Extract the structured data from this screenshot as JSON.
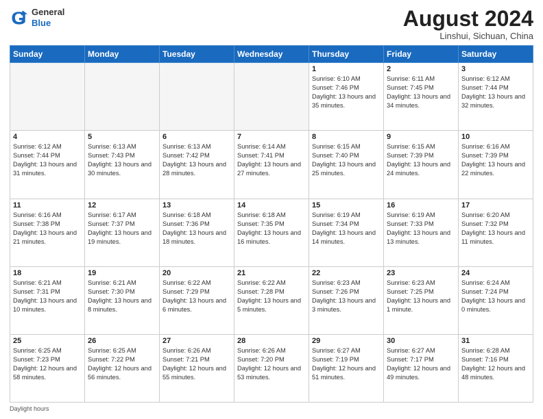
{
  "header": {
    "logo_general": "General",
    "logo_blue": "Blue",
    "month_title": "August 2024",
    "location": "Linshui, Sichuan, China"
  },
  "days_of_week": [
    "Sunday",
    "Monday",
    "Tuesday",
    "Wednesday",
    "Thursday",
    "Friday",
    "Saturday"
  ],
  "weeks": [
    [
      {
        "day": "",
        "empty": true
      },
      {
        "day": "",
        "empty": true
      },
      {
        "day": "",
        "empty": true
      },
      {
        "day": "",
        "empty": true
      },
      {
        "day": "1",
        "sunrise": "6:10 AM",
        "sunset": "7:46 PM",
        "daylight": "13 hours and 35 minutes."
      },
      {
        "day": "2",
        "sunrise": "6:11 AM",
        "sunset": "7:45 PM",
        "daylight": "13 hours and 34 minutes."
      },
      {
        "day": "3",
        "sunrise": "6:12 AM",
        "sunset": "7:44 PM",
        "daylight": "13 hours and 32 minutes."
      }
    ],
    [
      {
        "day": "4",
        "sunrise": "6:12 AM",
        "sunset": "7:44 PM",
        "daylight": "13 hours and 31 minutes."
      },
      {
        "day": "5",
        "sunrise": "6:13 AM",
        "sunset": "7:43 PM",
        "daylight": "13 hours and 30 minutes."
      },
      {
        "day": "6",
        "sunrise": "6:13 AM",
        "sunset": "7:42 PM",
        "daylight": "13 hours and 28 minutes."
      },
      {
        "day": "7",
        "sunrise": "6:14 AM",
        "sunset": "7:41 PM",
        "daylight": "13 hours and 27 minutes."
      },
      {
        "day": "8",
        "sunrise": "6:15 AM",
        "sunset": "7:40 PM",
        "daylight": "13 hours and 25 minutes."
      },
      {
        "day": "9",
        "sunrise": "6:15 AM",
        "sunset": "7:39 PM",
        "daylight": "13 hours and 24 minutes."
      },
      {
        "day": "10",
        "sunrise": "6:16 AM",
        "sunset": "7:39 PM",
        "daylight": "13 hours and 22 minutes."
      }
    ],
    [
      {
        "day": "11",
        "sunrise": "6:16 AM",
        "sunset": "7:38 PM",
        "daylight": "13 hours and 21 minutes."
      },
      {
        "day": "12",
        "sunrise": "6:17 AM",
        "sunset": "7:37 PM",
        "daylight": "13 hours and 19 minutes."
      },
      {
        "day": "13",
        "sunrise": "6:18 AM",
        "sunset": "7:36 PM",
        "daylight": "13 hours and 18 minutes."
      },
      {
        "day": "14",
        "sunrise": "6:18 AM",
        "sunset": "7:35 PM",
        "daylight": "13 hours and 16 minutes."
      },
      {
        "day": "15",
        "sunrise": "6:19 AM",
        "sunset": "7:34 PM",
        "daylight": "13 hours and 14 minutes."
      },
      {
        "day": "16",
        "sunrise": "6:19 AM",
        "sunset": "7:33 PM",
        "daylight": "13 hours and 13 minutes."
      },
      {
        "day": "17",
        "sunrise": "6:20 AM",
        "sunset": "7:32 PM",
        "daylight": "13 hours and 11 minutes."
      }
    ],
    [
      {
        "day": "18",
        "sunrise": "6:21 AM",
        "sunset": "7:31 PM",
        "daylight": "13 hours and 10 minutes."
      },
      {
        "day": "19",
        "sunrise": "6:21 AM",
        "sunset": "7:30 PM",
        "daylight": "13 hours and 8 minutes."
      },
      {
        "day": "20",
        "sunrise": "6:22 AM",
        "sunset": "7:29 PM",
        "daylight": "13 hours and 6 minutes."
      },
      {
        "day": "21",
        "sunrise": "6:22 AM",
        "sunset": "7:28 PM",
        "daylight": "13 hours and 5 minutes."
      },
      {
        "day": "22",
        "sunrise": "6:23 AM",
        "sunset": "7:26 PM",
        "daylight": "13 hours and 3 minutes."
      },
      {
        "day": "23",
        "sunrise": "6:23 AM",
        "sunset": "7:25 PM",
        "daylight": "13 hours and 1 minute."
      },
      {
        "day": "24",
        "sunrise": "6:24 AM",
        "sunset": "7:24 PM",
        "daylight": "13 hours and 0 minutes."
      }
    ],
    [
      {
        "day": "25",
        "sunrise": "6:25 AM",
        "sunset": "7:23 PM",
        "daylight": "12 hours and 58 minutes."
      },
      {
        "day": "26",
        "sunrise": "6:25 AM",
        "sunset": "7:22 PM",
        "daylight": "12 hours and 56 minutes."
      },
      {
        "day": "27",
        "sunrise": "6:26 AM",
        "sunset": "7:21 PM",
        "daylight": "12 hours and 55 minutes."
      },
      {
        "day": "28",
        "sunrise": "6:26 AM",
        "sunset": "7:20 PM",
        "daylight": "12 hours and 53 minutes."
      },
      {
        "day": "29",
        "sunrise": "6:27 AM",
        "sunset": "7:19 PM",
        "daylight": "12 hours and 51 minutes."
      },
      {
        "day": "30",
        "sunrise": "6:27 AM",
        "sunset": "7:17 PM",
        "daylight": "12 hours and 49 minutes."
      },
      {
        "day": "31",
        "sunrise": "6:28 AM",
        "sunset": "7:16 PM",
        "daylight": "12 hours and 48 minutes."
      }
    ]
  ],
  "footer": {
    "daylight_label": "Daylight hours"
  }
}
